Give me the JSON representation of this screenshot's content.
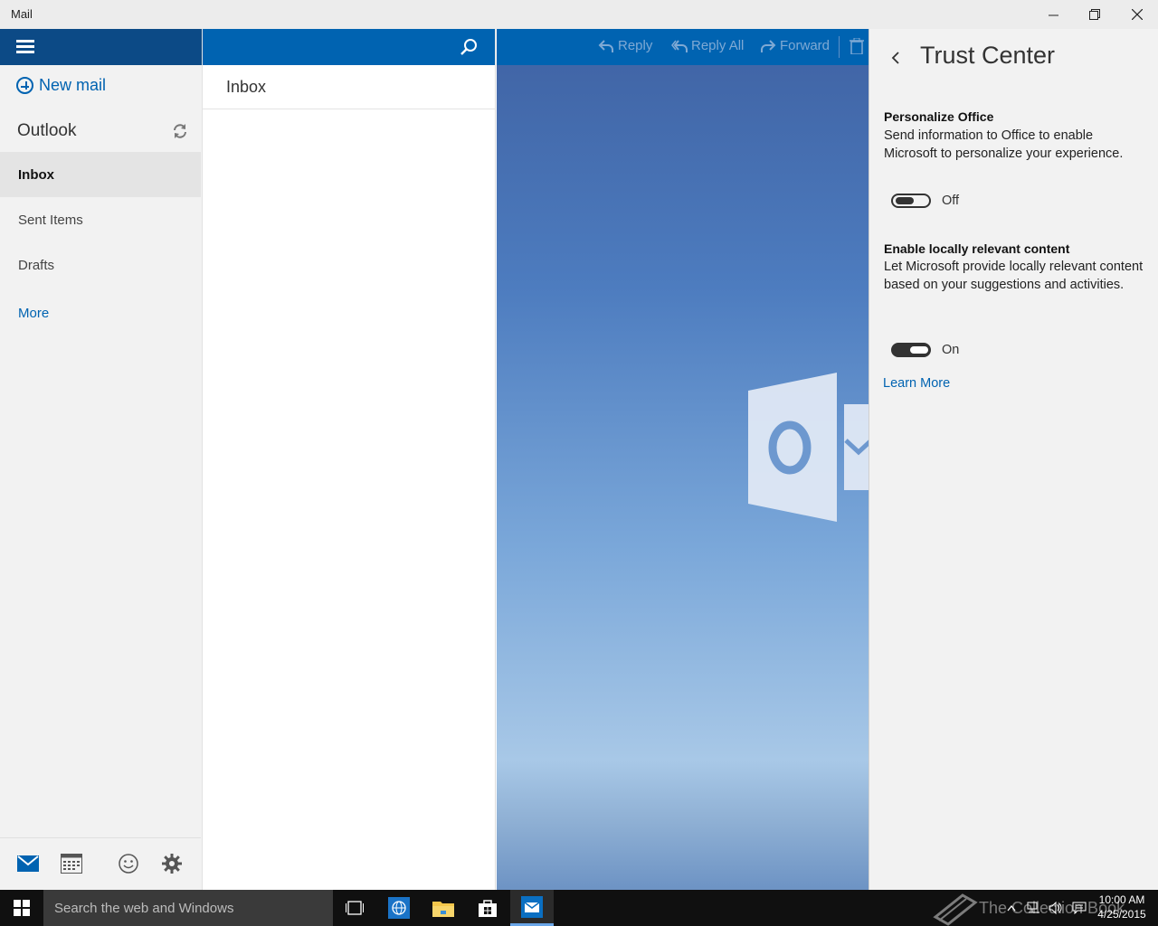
{
  "window": {
    "title": "Mail"
  },
  "leftnav": {
    "new_mail_label": "New mail",
    "account_name": "Outlook",
    "folders": [
      {
        "label": "Inbox",
        "active": true
      },
      {
        "label": "Sent Items",
        "active": false
      },
      {
        "label": "Drafts",
        "active": false
      }
    ],
    "more_label": "More"
  },
  "message_list": {
    "header": "Inbox"
  },
  "reading_toolbar": {
    "reply_label": "Reply",
    "reply_all_label": "Reply All",
    "forward_label": "Forward"
  },
  "trust_center": {
    "title": "Trust Center",
    "settings": [
      {
        "title": "Personalize Office",
        "description": "Send information to Office to enable Microsoft to personalize your experience.",
        "state_label": "Off",
        "enabled": false
      },
      {
        "title": "Enable locally relevant content",
        "description": "Let Microsoft provide locally relevant content based on your suggestions and activities.",
        "state_label": "On",
        "enabled": true
      }
    ],
    "learn_more_label": "Learn More"
  },
  "taskbar": {
    "search_placeholder": "Search the web and Windows",
    "watermark": "The Collection Book",
    "time": "10:00 AM",
    "date": "4/25/2015"
  },
  "colors": {
    "accent": "#0063b1",
    "nav_header": "#0c4a86",
    "panel_bg": "#f2f2f2",
    "taskbar": "#101010"
  }
}
